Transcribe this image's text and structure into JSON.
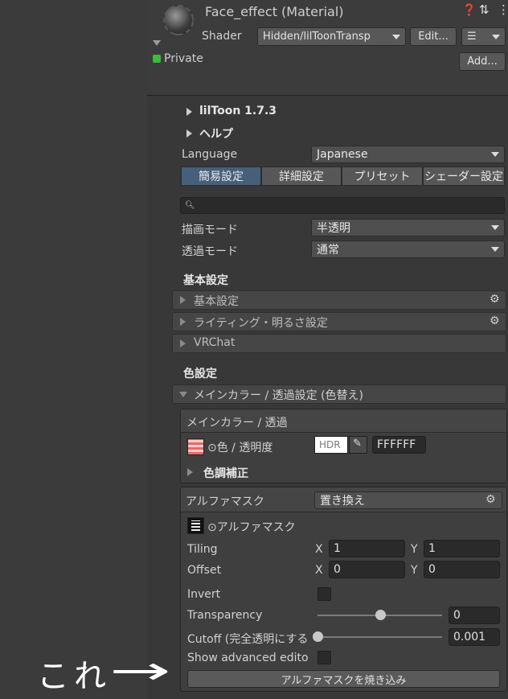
{
  "header": {
    "title": "Face_effect (Material)",
    "shader_label": "Shader",
    "shader_value": "Hidden/lilToonTransp",
    "edit_button": "Edit...",
    "private_label": "Private",
    "add_button": "Add..."
  },
  "inspector": {
    "liltoon_title": "lilToon 1.7.3",
    "help_title": "ヘルプ",
    "language_label": "Language",
    "language_value": "Japanese",
    "tabs": [
      "簡易設定",
      "詳細設定",
      "プリセット",
      "シェーダー設定"
    ],
    "active_tab": 0,
    "render_mode_label": "描画モード",
    "render_mode_value": "半透明",
    "transparent_mode_label": "透過モード",
    "transparent_mode_value": "通常",
    "basic_header": "基本設定",
    "foldouts": [
      "基本設定",
      "ライティング・明るさ設定",
      "VRChat"
    ],
    "color_header": "色設定",
    "main_color_foldout": "メインカラー / 透過設定 (色替え)",
    "main_color_box_title": "メインカラー / 透過",
    "color_alpha_label": "⊙色 / 透明度",
    "hdr_label": "HDR",
    "hex_value": "FFFFFF",
    "tone_correction": "色調補正",
    "alpha_mask": {
      "title": "アルファマスク",
      "mode_value": "置き換え",
      "texture_label": "⊙アルファマスク",
      "tiling_label": "Tiling",
      "offset_label": "Offset",
      "x_label": "X",
      "y_label": "Y",
      "tiling_x": "1",
      "tiling_y": "1",
      "offset_x": "0",
      "offset_y": "0",
      "invert_label": "Invert",
      "transparency_label": "Transparency",
      "transparency_value": "0",
      "transparency_fraction": 0.5,
      "cutoff_label": "Cutoff (完全透明にする",
      "cutoff_value": "0.001",
      "cutoff_fraction": 0.001,
      "show_advanced_label": "Show advanced edito",
      "bake_button": "アルファマスクを焼き込み"
    }
  },
  "annotation": {
    "text": "これ",
    "arrow": "→"
  },
  "colors": {
    "active_tab": "#46607c",
    "private_check": "#3dbb3d"
  }
}
